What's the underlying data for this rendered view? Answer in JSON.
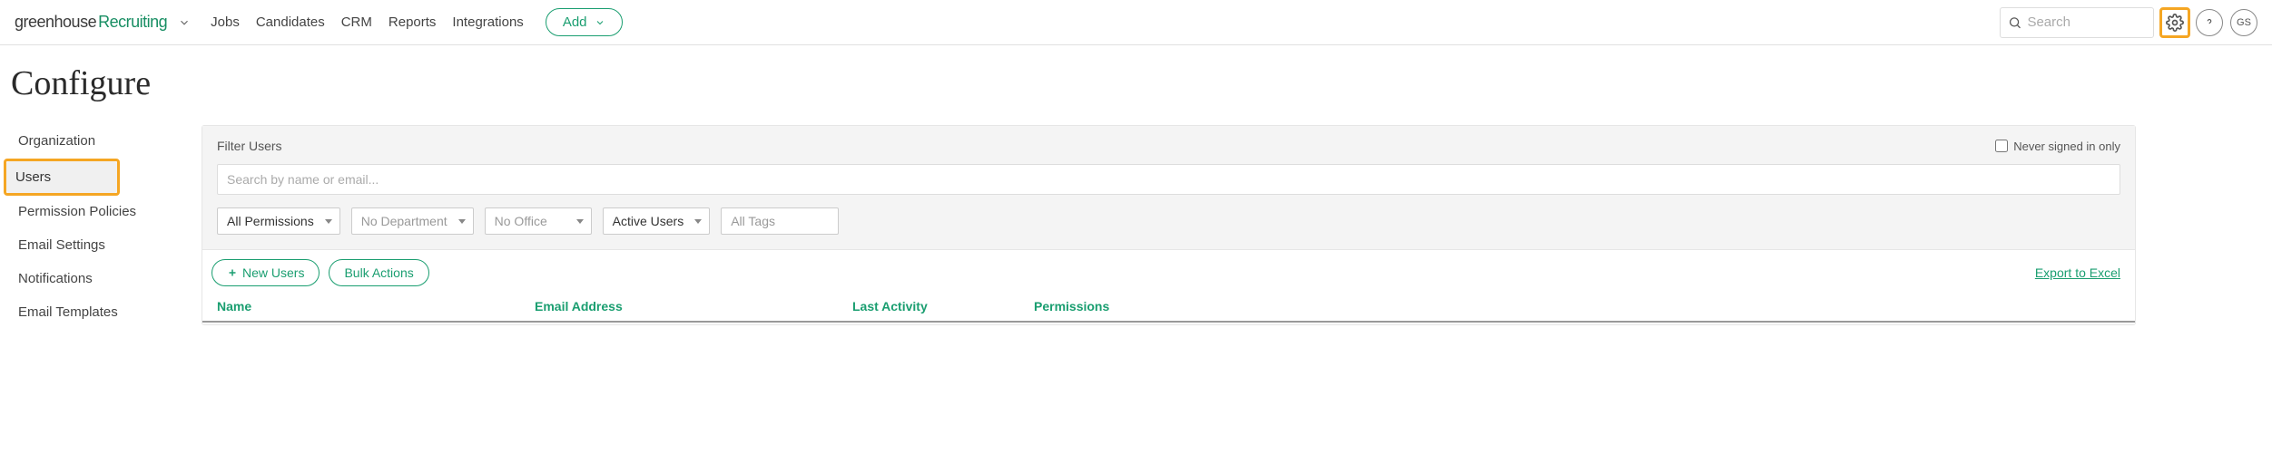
{
  "header": {
    "logo_part1": "greenhouse",
    "logo_part2": "Recruiting",
    "nav": [
      "Jobs",
      "Candidates",
      "CRM",
      "Reports",
      "Integrations"
    ],
    "add_label": "Add",
    "search_placeholder": "Search",
    "avatar_initials": "GS"
  },
  "page": {
    "title": "Configure"
  },
  "sidebar": {
    "items": [
      {
        "label": "Organization",
        "active": false
      },
      {
        "label": "Users",
        "active": true
      },
      {
        "label": "Permission Policies",
        "active": false
      },
      {
        "label": "Email Settings",
        "active": false
      },
      {
        "label": "Notifications",
        "active": false
      },
      {
        "label": "Email Templates",
        "active": false
      }
    ]
  },
  "filter": {
    "title": "Filter Users",
    "never_signed_label": "Never signed in only",
    "search_placeholder": "Search by name or email...",
    "dropdowns": {
      "permissions": "All Permissions",
      "department": "No Department",
      "office": "No Office",
      "status": "Active Users",
      "tags": "All Tags"
    }
  },
  "actions": {
    "new_users": "New Users",
    "bulk_actions": "Bulk Actions",
    "export": "Export to Excel"
  },
  "table": {
    "columns": {
      "name": "Name",
      "email": "Email Address",
      "activity": "Last Activity",
      "permissions": "Permissions"
    }
  }
}
